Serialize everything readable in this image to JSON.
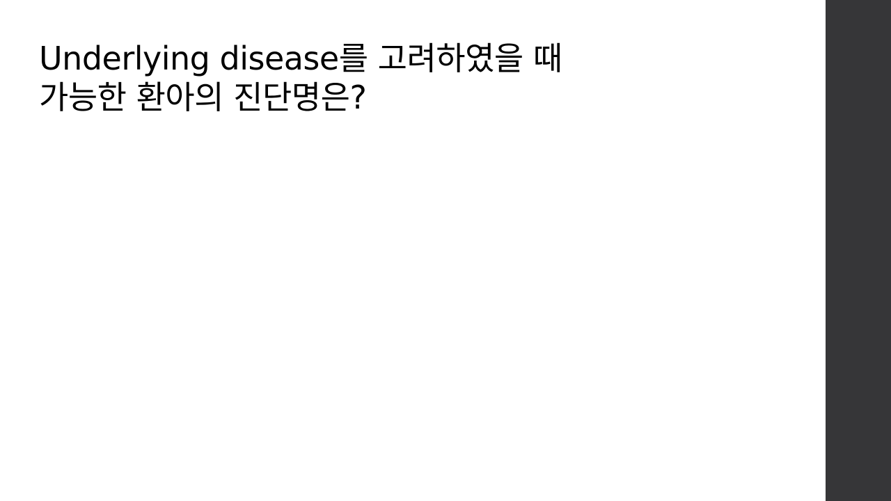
{
  "slide": {
    "title_lines": [
      "Underlying disease를 고려하였을 때",
      "가능한 환아의 진단명은?"
    ]
  },
  "colors": {
    "background": "#ffffff",
    "side_bar": "#363638",
    "text": "#000000"
  }
}
